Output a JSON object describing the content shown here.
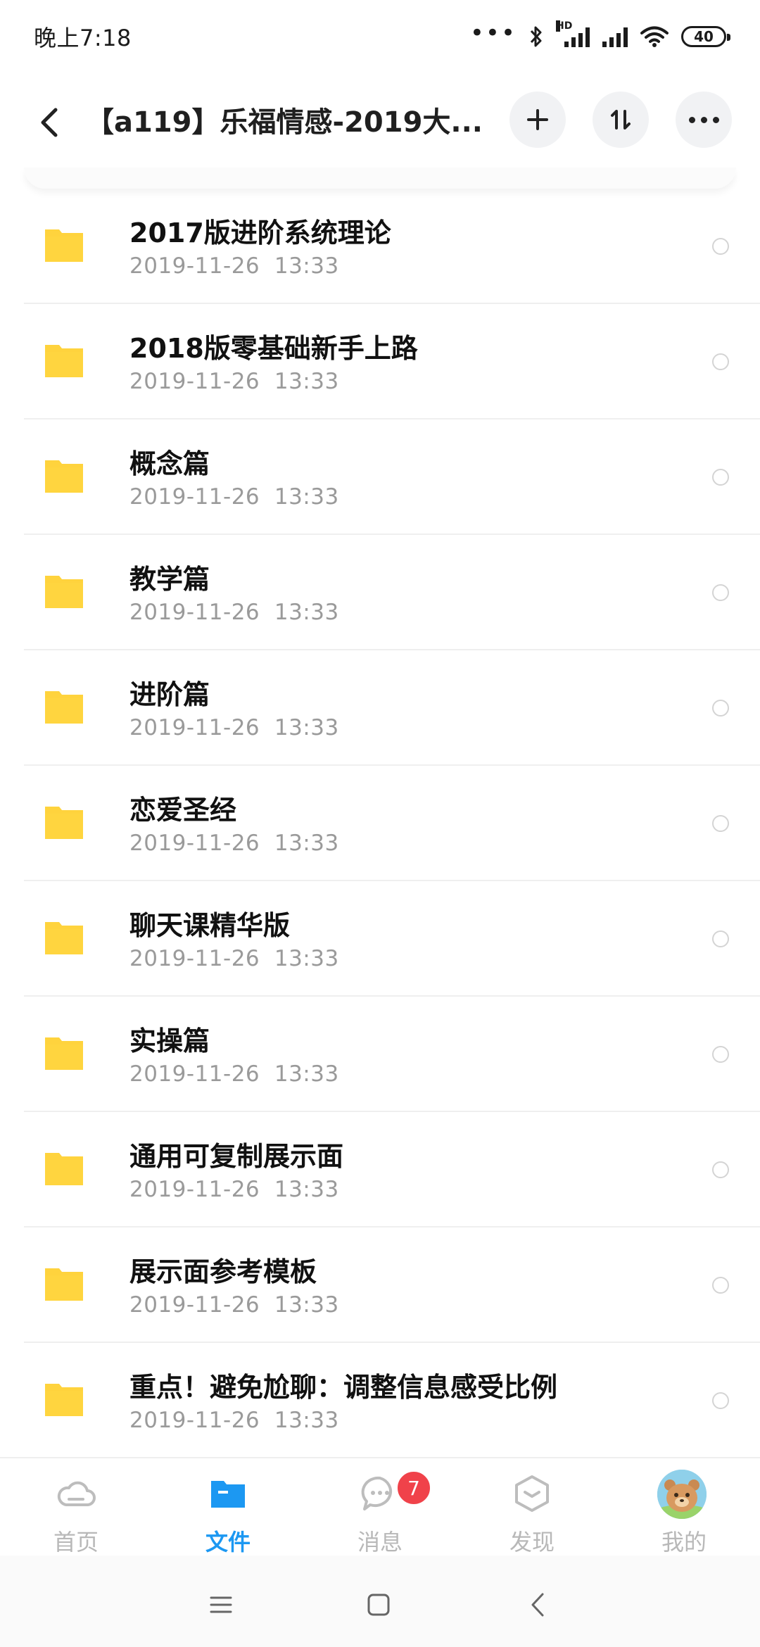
{
  "status_bar": {
    "time": "晚上7:18",
    "dots": "•••",
    "hd_label": "HD",
    "battery": "40"
  },
  "header": {
    "title": "【a119】乐福情感-2019大..."
  },
  "files": [
    {
      "name": "2017版进阶系统理论",
      "date": "2019-11-26  13:33"
    },
    {
      "name": "2018版零基础新手上路",
      "date": "2019-11-26  13:33"
    },
    {
      "name": "概念篇",
      "date": "2019-11-26  13:33"
    },
    {
      "name": "教学篇",
      "date": "2019-11-26  13:33"
    },
    {
      "name": "进阶篇",
      "date": "2019-11-26  13:33"
    },
    {
      "name": "恋爱圣经",
      "date": "2019-11-26  13:33"
    },
    {
      "name": "聊天课精华版",
      "date": "2019-11-26  13:33"
    },
    {
      "name": "实操篇",
      "date": "2019-11-26  13:33"
    },
    {
      "name": "通用可复制展示面",
      "date": "2019-11-26  13:33"
    },
    {
      "name": "展示面参考模板",
      "date": "2019-11-26  13:33"
    },
    {
      "name": "重点！避免尬聊：调整信息感受比例",
      "date": "2019-11-26  13:33"
    }
  ],
  "bottom_nav": {
    "items": [
      {
        "label": "首页",
        "icon": "cloud-icon"
      },
      {
        "label": "文件",
        "icon": "folder-icon",
        "active": true
      },
      {
        "label": "消息",
        "icon": "chat-bubble-icon",
        "badge": "7"
      },
      {
        "label": "发现",
        "icon": "discover-box-icon"
      },
      {
        "label": "我的",
        "icon": "avatar"
      }
    ]
  },
  "colors": {
    "accent": "#1c98f2",
    "folder": "#ffd33d",
    "badge": "#f0424a",
    "muted_text": "#9a9a9a"
  }
}
